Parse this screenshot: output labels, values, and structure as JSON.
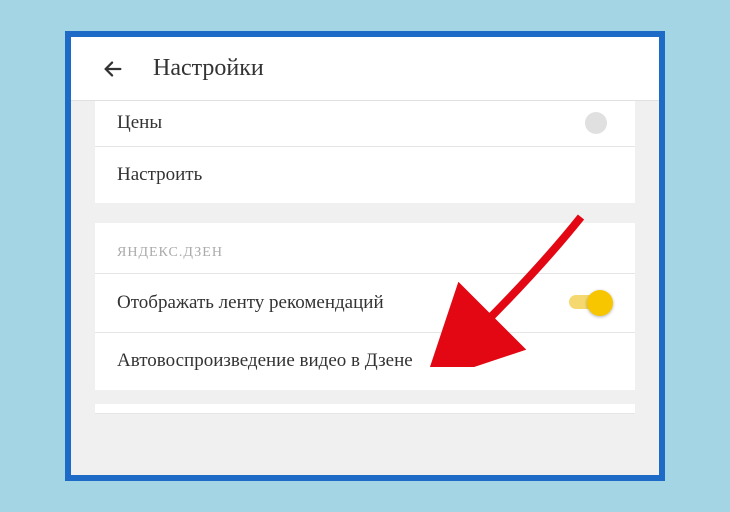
{
  "header": {
    "title": "Настройки"
  },
  "rows": {
    "prices": "Цены",
    "configure": "Настроить"
  },
  "zen": {
    "section_title": "ЯНДЕКС.ДЗЕН",
    "show_feed": "Отображать ленту рекомендаций",
    "autoplay": "Автовоспроизведение видео в Дзене",
    "toggle_on": true
  },
  "colors": {
    "accent": "#f7c600",
    "frame": "#1e6bc7",
    "annotation": "#e30613"
  }
}
